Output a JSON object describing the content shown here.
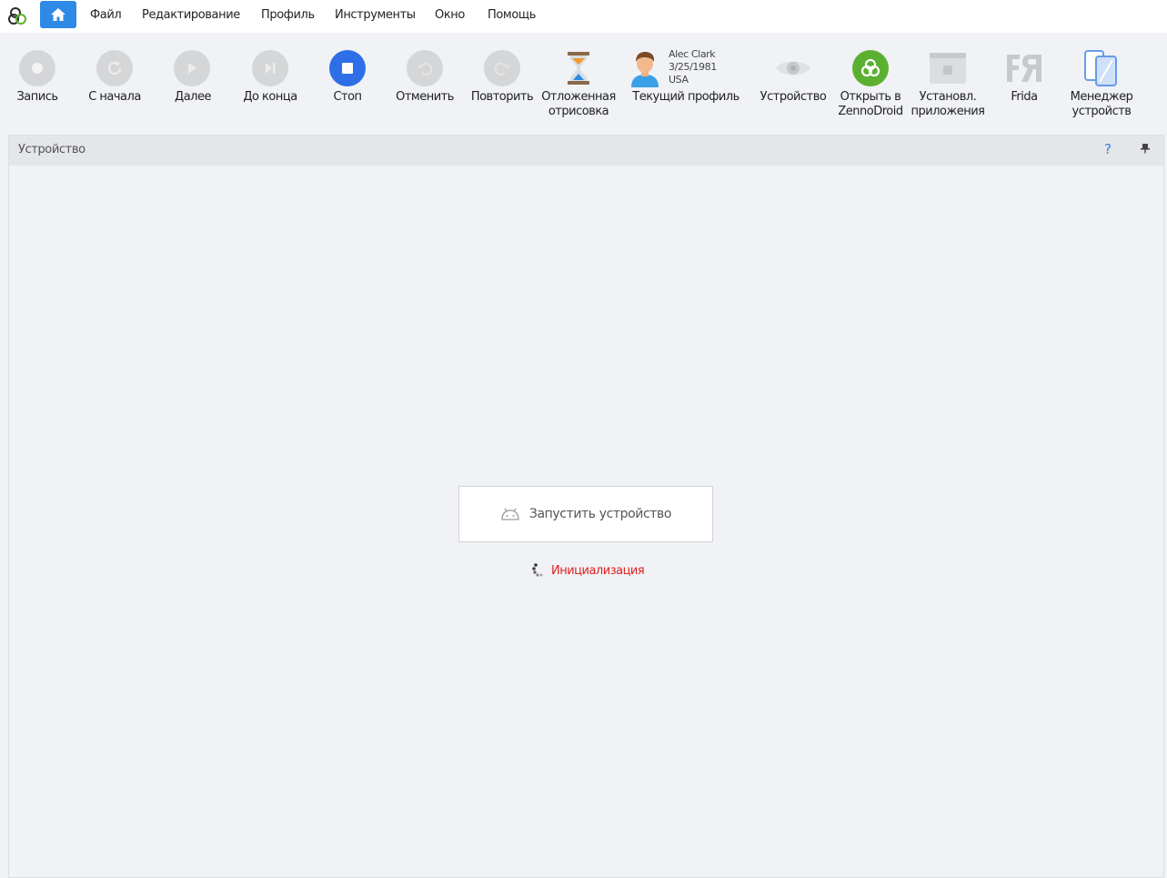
{
  "menubar": {
    "items": [
      "Файл",
      "Редактирование",
      "Профиль",
      "Инструменты",
      "Окно",
      "Помощь"
    ]
  },
  "toolbar": {
    "record": "Запись",
    "restart": "С начала",
    "next": "Далее",
    "to_end": "До конца",
    "stop": "Стоп",
    "undo": "Отменить",
    "redo": "Повторить",
    "deferred_line1": "Отложенная",
    "deferred_line2": "отрисовка",
    "profile_label": "Текущий профиль",
    "device": "Устройство",
    "open_zd_line1": "Открыть в",
    "open_zd_line2": "ZennoDroid",
    "install_line1": "Установл.",
    "install_line2": "приложения",
    "frida": "Frida",
    "manager_line1": "Менеджер",
    "manager_line2": "устройств"
  },
  "profile": {
    "name": "Alec Clark",
    "birthdate": "3/25/1981",
    "country": "USA"
  },
  "panel": {
    "title": "Устройство",
    "help": "?",
    "start_button": "Запустить устройство",
    "status": "Инициализация"
  },
  "colors": {
    "accent_blue": "#2e8ae6",
    "stop_blue": "#2e6fe8",
    "zenno_green": "#5cb030",
    "status_red": "#e02020"
  }
}
